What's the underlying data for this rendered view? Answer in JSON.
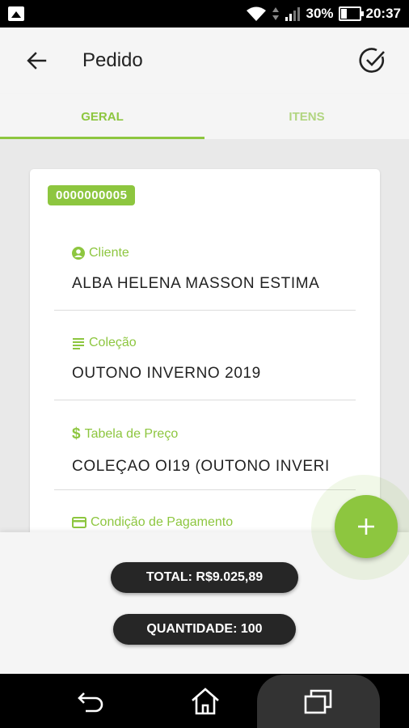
{
  "status_bar": {
    "battery": "30%",
    "time": "20:37"
  },
  "app_bar": {
    "title": "Pedido"
  },
  "tabs": [
    {
      "label": "GERAL"
    },
    {
      "label": "ITENS"
    }
  ],
  "order": {
    "number": "0000000005",
    "fields": [
      {
        "label": "Cliente",
        "value": "ALBA HELENA MASSON ESTIMA",
        "icon": "user-circle-icon"
      },
      {
        "label": "Coleção",
        "value": "OUTONO INVERNO 2019",
        "icon": "list-icon"
      },
      {
        "label": "Tabela de Preço",
        "value": "COLEÇAO OI19 (OUTONO INVERI",
        "icon": "dollar-icon"
      },
      {
        "label": "Condição de Pagamento",
        "value": "",
        "icon": "credit-card-icon"
      }
    ]
  },
  "summary": {
    "total": "TOTAL: R$9.025,89",
    "quantity": "QUANTIDADE: 100"
  },
  "colors": {
    "accent": "#8dc63f",
    "pill": "#262626"
  }
}
